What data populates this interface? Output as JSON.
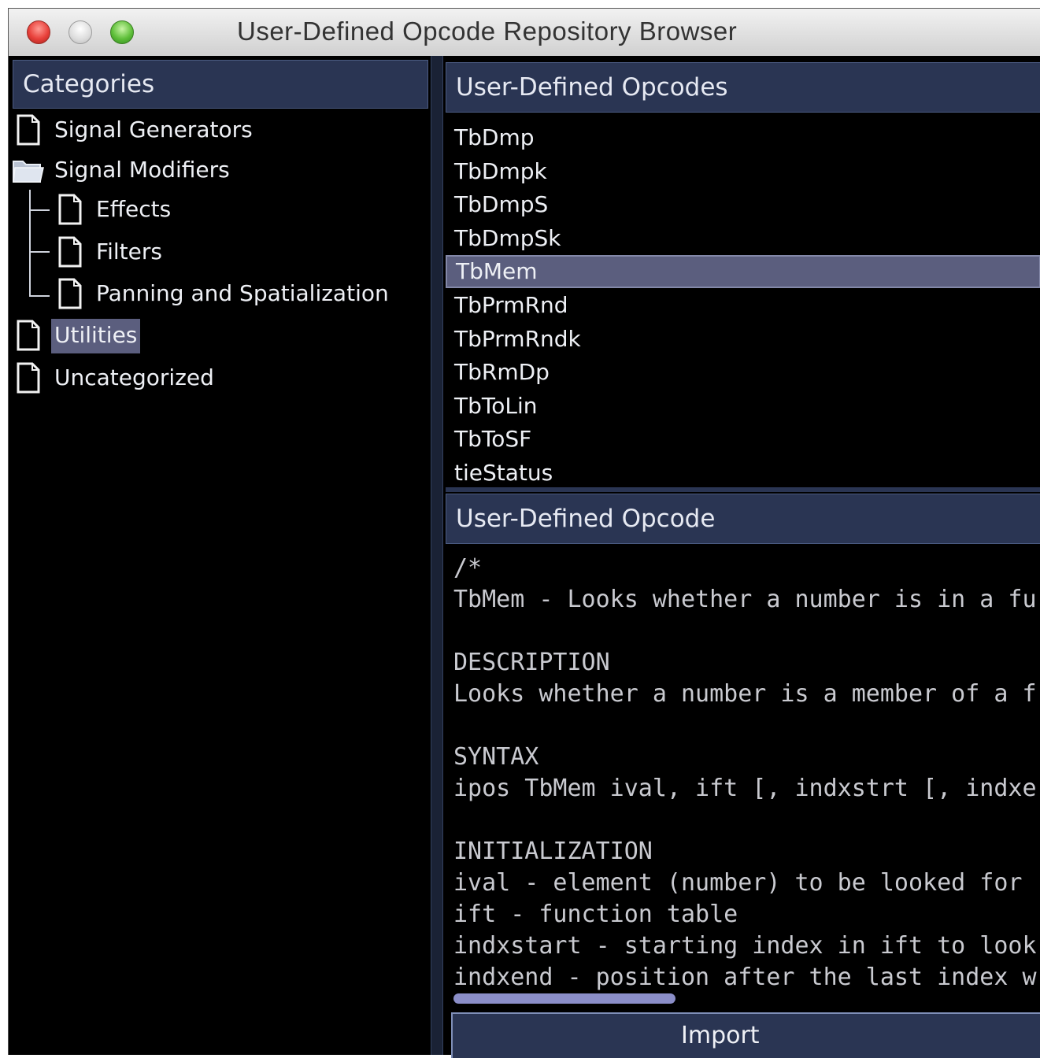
{
  "window": {
    "title": "User-Defined Opcode Repository Browser"
  },
  "categories": {
    "header": "Categories",
    "items": [
      {
        "label": "Signal Generators",
        "icon": "document-icon",
        "level": 0
      },
      {
        "label": "Signal Modifiers",
        "icon": "folder-open-icon",
        "level": 0
      },
      {
        "label": "Effects",
        "icon": "document-icon",
        "level": 1
      },
      {
        "label": "Filters",
        "icon": "document-icon",
        "level": 1
      },
      {
        "label": "Panning and Spatialization",
        "icon": "document-icon",
        "level": 1
      },
      {
        "label": "Utilities",
        "icon": "document-icon",
        "level": 0,
        "selected": true
      },
      {
        "label": "Uncategorized",
        "icon": "document-icon",
        "level": 0
      }
    ]
  },
  "opcode_list": {
    "header": "User-Defined Opcodes",
    "items": [
      "TbDmp",
      "TbDmpk",
      "TbDmpS",
      "TbDmpSk",
      "TbMem",
      "TbPrmRnd",
      "TbPrmRndk",
      "TbRmDp",
      "TbToLin",
      "TbToSF",
      "tieStatus"
    ],
    "selected": "TbMem"
  },
  "opcode_detail": {
    "header": "User-Defined Opcode",
    "lines": [
      "/*",
      "TbMem - Looks whether a number is in a fu",
      "",
      "DESCRIPTION",
      "Looks whether a number is a member of a f",
      "",
      "SYNTAX",
      "ipos TbMem ival, ift [, indxstrt [, indxe",
      "",
      "INITIALIZATION",
      "ival - element (number) to be looked for",
      "ift - function table",
      "indxstart - starting index in ift to look",
      "indxend - position after the last index w"
    ]
  },
  "import_button": {
    "label": "Import"
  },
  "colors": {
    "panel_bg": "#000000",
    "header_bg": "#2a3553",
    "selection": "#5b5e7e",
    "scroll_thumb": "#8b8ec8"
  }
}
